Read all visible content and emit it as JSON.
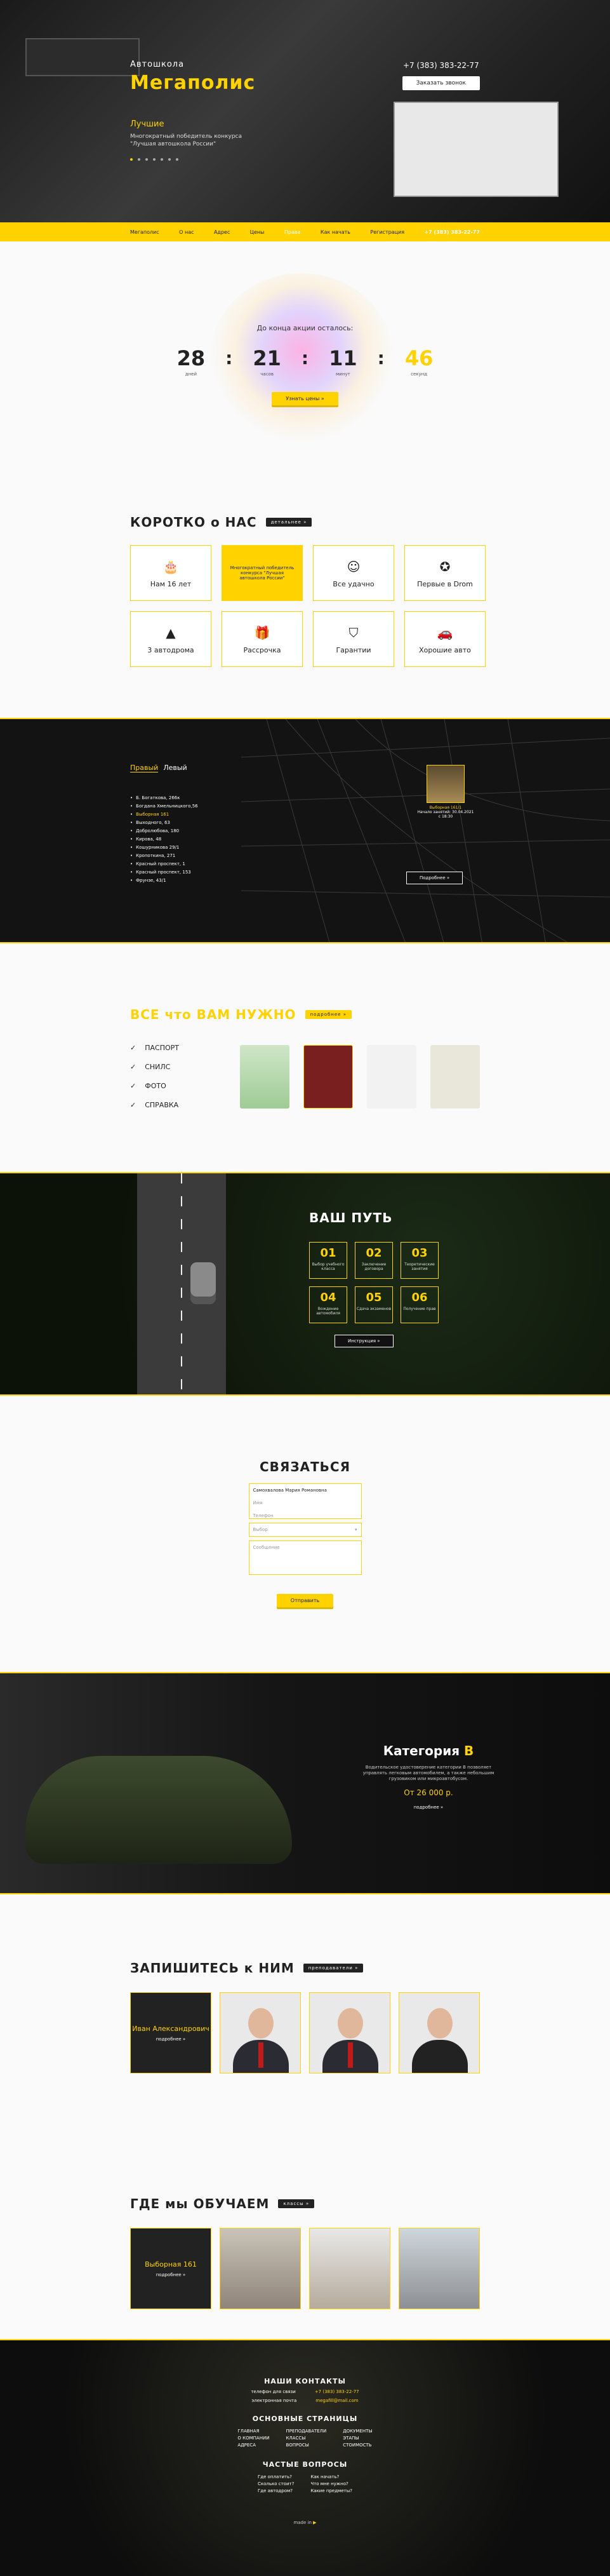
{
  "hero": {
    "subtitle": "Автошкола",
    "title": "Мегаполис",
    "slide_title": "Лучшие",
    "slide_desc": "Многократный победитель конкурса \"Лучшая автошкола России\"",
    "phone": "+7 (383) 383-22-77",
    "call_button": "Заказать звонок"
  },
  "nav": {
    "logo": "Мегаполис",
    "items": [
      "О нас",
      "Адрес",
      "Цены",
      "Права",
      "Как начать",
      "Регистрация"
    ],
    "phone": "+7 (383) 383-22-77"
  },
  "timer": {
    "title": "До конца акции осталось:",
    "days": "28",
    "hours": "21",
    "minutes": "11",
    "seconds": "46",
    "days_lbl": "дней",
    "hours_lbl": "часов",
    "minutes_lbl": "минут",
    "seconds_lbl": "секунд",
    "button": "Узнать цены »"
  },
  "about": {
    "title": "КОРОТКО о НАС",
    "tag": "детальнее »",
    "cards": [
      {
        "label": "Нам 16 лет",
        "icon": "cake-icon"
      },
      {
        "label": "Многократный победитель конкурса \"Лучшая автошкола России\"",
        "icon": ""
      },
      {
        "label": "Все удачно",
        "icon": "smile-icon"
      },
      {
        "label": "Первые в Drom",
        "icon": "medal-icon"
      },
      {
        "label": "3 автодрома",
        "icon": "cone-icon"
      },
      {
        "label": "Рассрочка",
        "icon": "gift-icon"
      },
      {
        "label": "Гарантии",
        "icon": "shield-icon"
      },
      {
        "label": "Хорошие авто",
        "icon": "car-icon"
      }
    ]
  },
  "map": {
    "tab_right": "Правый",
    "tab_left": "Левый",
    "addresses": [
      "Б. Богаткова, 266к",
      "Богдана Хмельницкого,56",
      "Выборная 161",
      "Выходного, 63",
      "Добролюбова, 180",
      "Кирова, 48",
      "Кошурникова 29/1",
      "Кропоткина, 271",
      "Красный проспект, 1",
      "Красный проспект, 153",
      "Фрунзе, 43/1"
    ],
    "card_title": "Выборная 161/1",
    "card_text": "Начало занятий: 30.04.2021",
    "card_time": "с 18:30",
    "button": "Подробнее »"
  },
  "docs": {
    "title": "ВСЕ что ВАМ НУЖНО",
    "tag": "подробнее »",
    "items": [
      "ПАСПОРТ",
      "СНИЛС",
      "ФОТО",
      "СПРАВКА"
    ]
  },
  "path": {
    "title": "ВАШ ПУТЬ",
    "steps": [
      {
        "n": "01",
        "t": "Выбор учебного класса"
      },
      {
        "n": "02",
        "t": "Заключение договора"
      },
      {
        "n": "03",
        "t": "Теоретические занятия"
      },
      {
        "n": "04",
        "t": "Вождение автомобиля"
      },
      {
        "n": "05",
        "t": "Сдача экзаменов"
      },
      {
        "n": "06",
        "t": "Получение прав"
      }
    ],
    "button": "Инструкция »"
  },
  "contact": {
    "title": "СВЯЗАТЬСЯ",
    "name_hint": "Самохвалова Мария Романовна",
    "ph_name": "Имя",
    "ph_phone": "Телефон",
    "ph_select": "Выбор",
    "ph_message": "Сообщение",
    "button": "Отправить"
  },
  "catb": {
    "title_prefix": "Категория",
    "title_letter": "B",
    "desc": "Водительское удостоверение категории B позволяет управлять легковым автомобилем, а также небольшим грузовиком или микроавтобусом.",
    "price": "От 26 000 р.",
    "more": "подробнее »"
  },
  "teachers": {
    "title": "ЗАПИШИТЕСЬ к НИМ",
    "tag": "преподаватели »",
    "first_name": "Иван Александрович",
    "more": "подробнее »"
  },
  "places": {
    "title": "ГДЕ мы ОБУЧАЕМ",
    "tag": "классы »",
    "first_name": "Выборная 161",
    "more": "подробнее »"
  },
  "footer": {
    "contacts_title": "НАШИ КОНТАКТЫ",
    "phone_label": "телефон для связи",
    "phone": "+7 (383) 383-22-77",
    "email_label": "электронная почта",
    "email": "megafill@mail.com",
    "pages_title": "ОСНОВНЫЕ СТРАНИЦЫ",
    "pages": [
      [
        "ГЛАВНАЯ",
        "О КОМПАНИИ",
        "АДРЕСА"
      ],
      [
        "ПРЕПОДАВАТЕЛИ",
        "КЛАССЫ",
        "ВОПРОСЫ"
      ],
      [
        "ДОКУМЕНТЫ",
        "ЭТАПЫ",
        "СТОИМОСТЬ"
      ]
    ],
    "faq_title": "ЧАСТЫЕ ВОПРОСЫ",
    "faq": [
      [
        "Где оплатить?",
        "Сколько стоит?",
        "Где автодром?"
      ],
      [
        "Как начать?",
        "Что мне нужно?",
        "Какие предметы?"
      ]
    ],
    "made_by": "made in"
  },
  "colors": {
    "accent": "#ffd200",
    "dark": "#131313"
  }
}
